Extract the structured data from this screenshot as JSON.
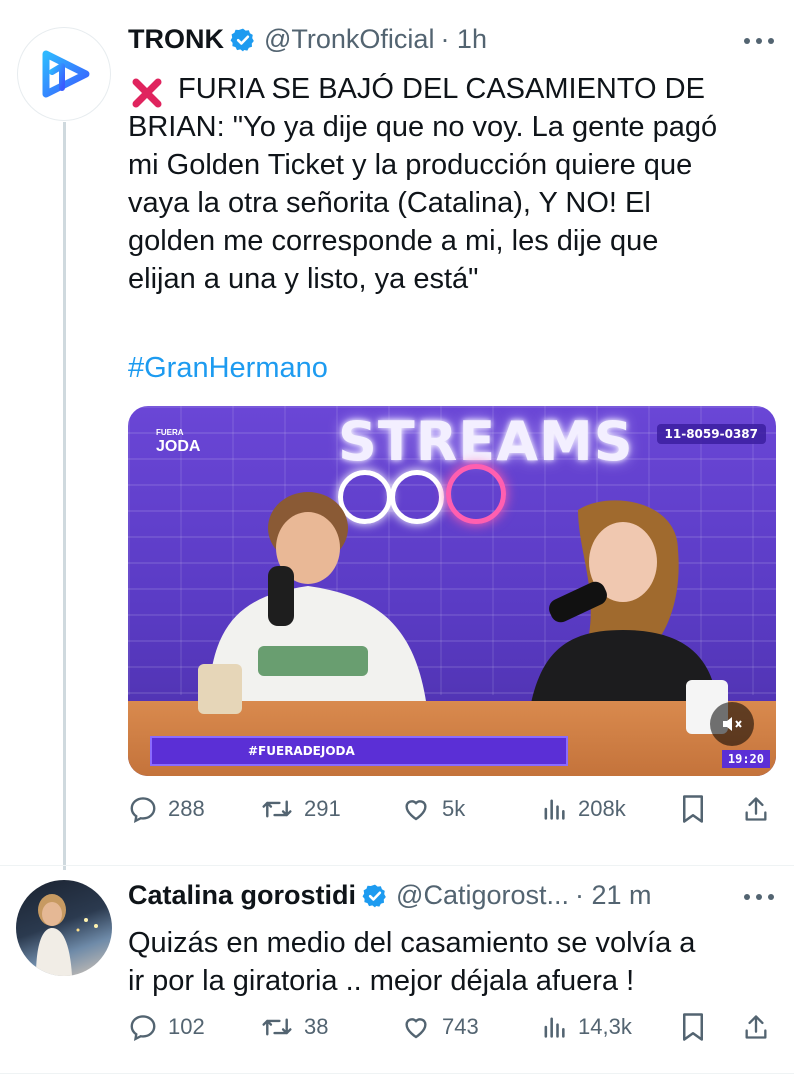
{
  "tweet1": {
    "name": "TRONK",
    "handle": "@TronkOficial",
    "time": "· 1h",
    "text": "FURIA SE BAJÓ DEL CASAMIENTO DE\nBRIAN: \"Yo ya dije que no voy. La gente pagó\nmi Golden Ticket y la producción quiere que\nvaya la otra señorita (Catalina), Y NO! El\ngolden me corresponde a mi, les dije que\nelijan a una y listo, ya está\"",
    "hashtag": "#GranHermano",
    "media": {
      "logo_small": "FUERA",
      "logo_big": "JODA",
      "streams": "STREAMS",
      "phone": "11-8059-0387",
      "banner": "#FUERADEJODA",
      "timestamp": "19:20"
    },
    "stats": {
      "replies": "288",
      "retweets": "291",
      "likes": "5k",
      "views": "208k"
    }
  },
  "tweet2": {
    "name": "Catalina gorostidi",
    "handle": "@Catigorost...",
    "time": "· 21 m",
    "text": "Quizás en medio del casamiento se volvía a\nir por la giratoria .. mejor déjala afuera !",
    "stats": {
      "replies": "102",
      "retweets": "38",
      "likes": "743",
      "views": "14,3k"
    }
  },
  "colors": {
    "accent": "#1d9bf0",
    "muted": "#536471",
    "media_purple": "#5a3bc4",
    "cross_red": "#e0245e"
  },
  "icons": [
    "reply-icon",
    "retweet-icon",
    "like-icon",
    "views-icon",
    "bookmark-icon",
    "share-icon",
    "verified-icon",
    "more-icon",
    "cross-mark-icon",
    "mute-icon"
  ]
}
